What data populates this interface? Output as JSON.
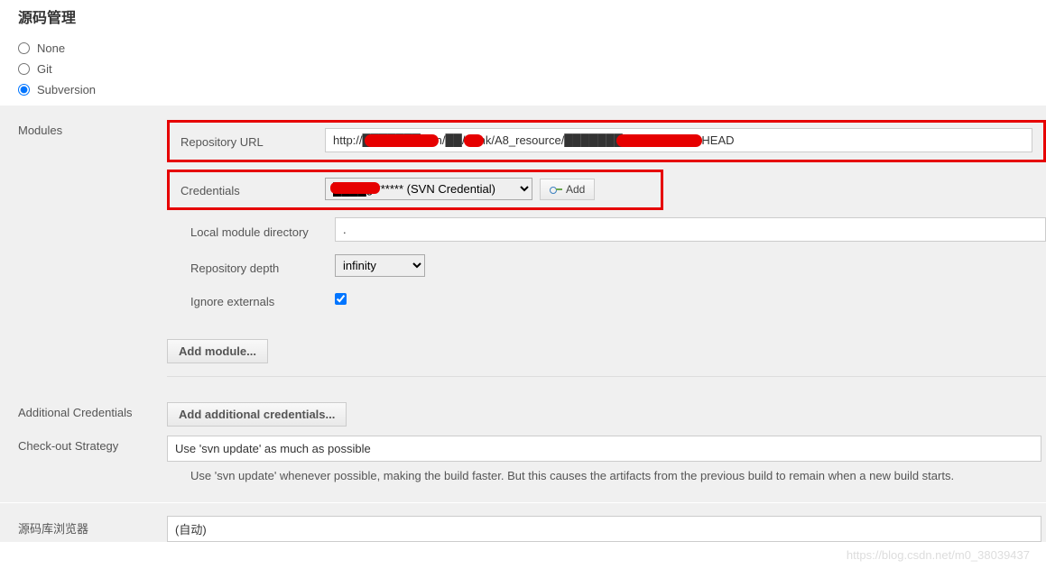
{
  "sectionTitle": "源码管理",
  "scmOptions": {
    "none": "None",
    "git": "Git",
    "subversion": "Subversion",
    "selected": "subversion"
  },
  "modules": {
    "label": "Modules",
    "repoUrl": {
      "label": "Repository URL",
      "value": "http://███████/svn/██/trunk/A8_resource/███████/Server/trunk@HEAD"
    },
    "credentials": {
      "label": "Credentials",
      "selected": "████g/****** (SVN Credential)",
      "addBtn": "Add"
    },
    "localDir": {
      "label": "Local module directory",
      "value": "."
    },
    "depth": {
      "label": "Repository depth",
      "value": "infinity"
    },
    "ignoreExternals": {
      "label": "Ignore externals",
      "checked": true
    },
    "addModuleBtn": "Add module..."
  },
  "additionalCredentials": {
    "label": "Additional Credentials",
    "btn": "Add additional credentials..."
  },
  "checkout": {
    "label": "Check-out Strategy",
    "value": "Use 'svn update' as much as possible",
    "desc": "Use 'svn update' whenever possible, making the build faster. But this causes the artifacts from the previous build to remain when a new build starts."
  },
  "repoBrowser": {
    "label": "源码库浏览器",
    "value": "(自动)"
  },
  "watermark": "https://blog.csdn.net/m0_38039437"
}
